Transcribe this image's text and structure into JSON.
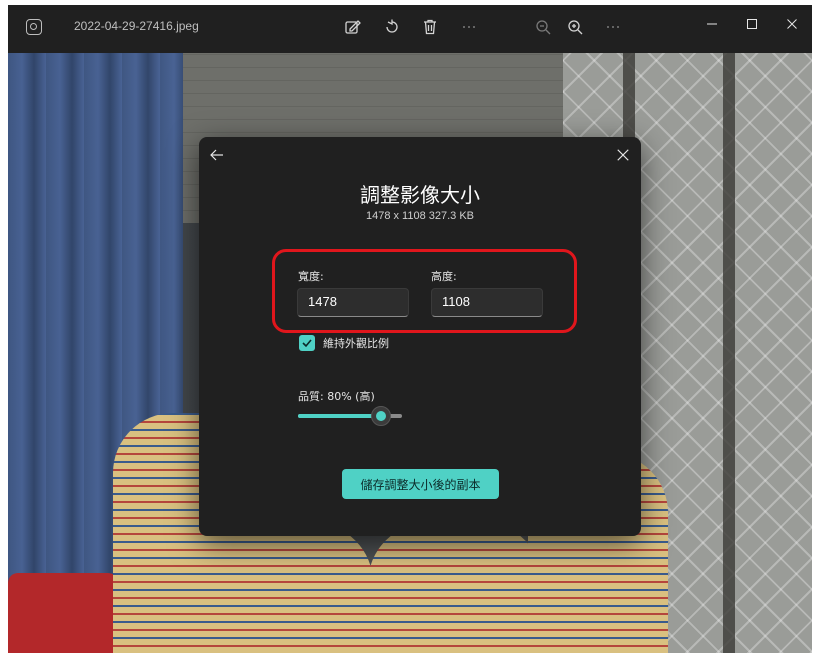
{
  "titlebar": {
    "file_name": "2022-04-29-27416.jpeg",
    "icons": [
      "edit-image-icon",
      "rotate-icon",
      "delete-icon",
      "more-icon",
      "zoom-out-icon",
      "zoom-in-icon",
      "more-icon"
    ],
    "window_controls": [
      "minimize-icon",
      "maximize-icon",
      "close-icon"
    ]
  },
  "dialog": {
    "title": "調整影像大小",
    "subtitle": "1478 x 1108   327.3 KB",
    "width_label": "寬度:",
    "width_value": "1478",
    "height_label": "高度:",
    "height_value": "1108",
    "aspect_label": "維持外觀比例",
    "aspect_checked": true,
    "quality_label": "品質: 80% (高)",
    "quality_value": 0.8,
    "save_label": "儲存調整大小後的副本"
  },
  "colors": {
    "accent": "#4fd1c5",
    "highlight": "#e0161c",
    "dialog_bg": "#202020"
  }
}
